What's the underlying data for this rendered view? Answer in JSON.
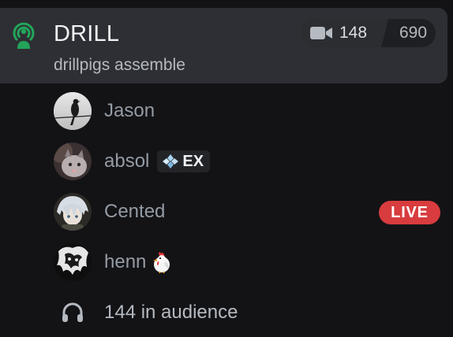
{
  "channel": {
    "name": "DRILL",
    "topic": "drillpigs assemble",
    "icon": "stage-icon",
    "accent_color": "#23a55a"
  },
  "user_count": {
    "icon": "video-camera-icon",
    "current": "148",
    "limit": "690"
  },
  "members": [
    {
      "name": "Jason",
      "avatar": "bird-on-wire-avatar"
    },
    {
      "name": "absol",
      "avatar": "cat-avatar",
      "badge": {
        "icon": "diamond-icon",
        "label": "EX"
      }
    },
    {
      "name": "Cented",
      "avatar": "anime-character-avatar",
      "status": "LIVE",
      "status_color": "#d83c3e"
    },
    {
      "name": "henn",
      "avatar": "dark-figure-avatar",
      "emoji": "chicken"
    }
  ],
  "audience": {
    "icon": "headphones-icon",
    "text": "144 in audience"
  }
}
